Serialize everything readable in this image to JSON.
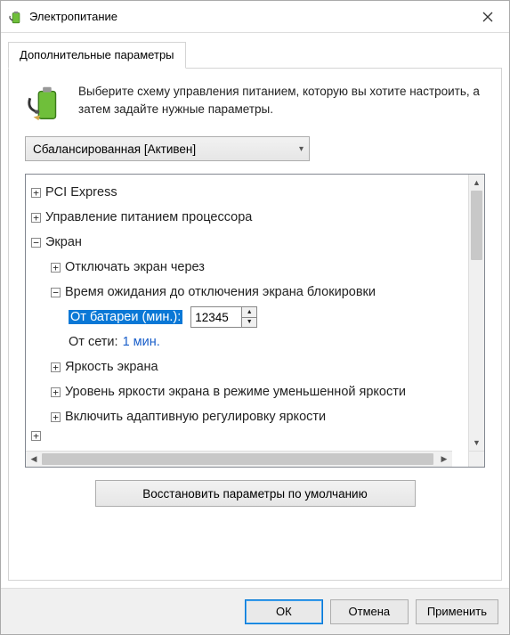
{
  "window": {
    "title": "Электропитание"
  },
  "tab": {
    "label": "Дополнительные параметры"
  },
  "intro": {
    "text": "Выберите схему управления питанием, которую вы хотите настроить, а затем задайте нужные параметры."
  },
  "scheme": {
    "selected": "Сбалансированная [Активен]"
  },
  "tree": {
    "pci": "PCI Express",
    "cpu": "Управление питанием процессора",
    "display": "Экран",
    "display_off": "Отключать экран через",
    "lock_timeout": "Время ожидания до отключения экрана блокировки",
    "on_battery_label": "От батареи (мин.):",
    "on_battery_value": "12345",
    "on_ac_label": "От сети:",
    "on_ac_value": "1 мин.",
    "brightness": "Яркость экрана",
    "dim_brightness": "Уровень яркости экрана в режиме уменьшенной яркости",
    "adaptive": "Включить адаптивную регулировку яркости"
  },
  "restore": {
    "label": "Восстановить параметры по умолчанию"
  },
  "buttons": {
    "ok": "ОК",
    "cancel": "Отмена",
    "apply": "Применить"
  }
}
